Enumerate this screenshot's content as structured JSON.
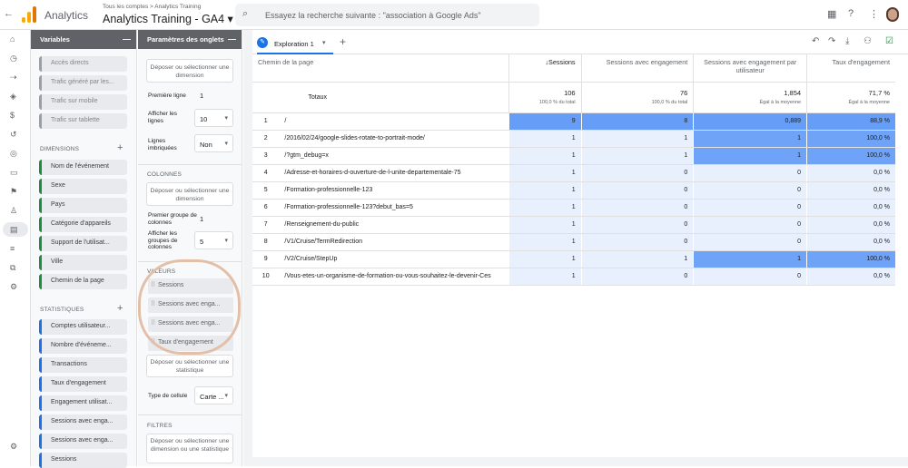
{
  "app": {
    "name": "Analytics",
    "breadcrumb": "Tous les comptes > Analytics Training",
    "property": "Analytics Training - GA4 ▾",
    "search_placeholder": "Essayez la recherche suivante : \"association à Google Ads\"",
    "logo_colors": [
      "#f9ab00",
      "#e37400"
    ]
  },
  "variables": {
    "title": "Variables",
    "segments": [
      "Accès directs",
      "Trafic généré par les...",
      "Trafic sur mobile",
      "Trafic sur tablette"
    ],
    "dimensions_label": "DIMENSIONS",
    "dimensions": [
      "Nom de l'événement",
      "Sexe",
      "Pays",
      "Catégorie d'appareils",
      "Support de l'utilisat...",
      "Ville",
      "Chemin de la page"
    ],
    "metrics_label": "STATISTIQUES",
    "metrics": [
      "Comptes utilisateur...",
      "Nombre d'événeme...",
      "Transactions",
      "Taux d'engagement",
      "Engagement utilisat...",
      "Sessions avec enga...",
      "Sessions avec enga...",
      "Sessions"
    ]
  },
  "settings": {
    "title": "Paramètres des onglets",
    "drop_top": "Déposer ou sélectionner une dimension",
    "first_row_label": "Première ligne",
    "first_row_value": "1",
    "show_rows_label": "Afficher les lignes",
    "show_rows_value": "10",
    "nested_label": "Lignes imbriquées",
    "nested_value": "Non",
    "columns_label": "COLONNES",
    "drop_col": "Déposer ou sélectionner une dimension",
    "first_col_group_label": "Premier groupe de colonnes",
    "first_col_group_value": "1",
    "show_col_groups_label": "Afficher les groupes de colonnes",
    "show_col_groups_value": "5",
    "values_label": "VALEURS",
    "values": [
      "Sessions",
      "Sessions avec enga...",
      "Sessions avec enga...",
      "Taux d'engagement"
    ],
    "drop_stat": "Déposer ou sélectionner une statistique",
    "cell_type_label": "Type de cellule",
    "cell_type_value": "Carte ...",
    "filters_label": "FILTRES",
    "drop_filter": "Déposer ou sélectionner une dimension ou une statistique"
  },
  "exploration": {
    "tab": "Exploration 1",
    "headers": [
      "Chemin de la page",
      "↓Sessions",
      "Sessions avec engagement",
      "Sessions avec engagement par utilisateur",
      "Taux d'engagement"
    ],
    "totals": {
      "label": "Totaux",
      "values": [
        "106",
        "76",
        "1,854",
        "71,7 %"
      ],
      "subs": [
        "100,0 % du total",
        "100,0 % du total",
        "Égal à la moyenne",
        "Égal à la moyenne"
      ]
    },
    "rows": [
      {
        "i": "1",
        "path": "/",
        "v": [
          "9",
          "8",
          "0,889",
          "88,9 %"
        ],
        "s": [
          1,
          1,
          1,
          1
        ]
      },
      {
        "i": "2",
        "path": "/2016/02/24/google-slides-rotate-to-portrait-mode/",
        "v": [
          "1",
          "1",
          "1",
          "100,0 %"
        ],
        "s": [
          0,
          0,
          2,
          2
        ]
      },
      {
        "i": "3",
        "path": "/?gtm_debug=x",
        "v": [
          "1",
          "1",
          "1",
          "100,0 %"
        ],
        "s": [
          0,
          0,
          2,
          2
        ]
      },
      {
        "i": "4",
        "path": "/Adresse-et-horaires-d-ouverture-de-l-unite-departementale-75",
        "v": [
          "1",
          "0",
          "0",
          "0,0 %"
        ],
        "s": [
          0,
          0,
          0,
          0
        ]
      },
      {
        "i": "5",
        "path": "/Formation-professionnelle-123",
        "v": [
          "1",
          "0",
          "0",
          "0,0 %"
        ],
        "s": [
          0,
          0,
          0,
          0
        ]
      },
      {
        "i": "6",
        "path": "/Formation-professionnelle-123?debut_bas=5",
        "v": [
          "1",
          "0",
          "0",
          "0,0 %"
        ],
        "s": [
          0,
          0,
          0,
          0
        ]
      },
      {
        "i": "7",
        "path": "/Renseignement-du-public",
        "v": [
          "1",
          "0",
          "0",
          "0,0 %"
        ],
        "s": [
          0,
          0,
          0,
          0
        ]
      },
      {
        "i": "8",
        "path": "/V1/Cruise/TermRedirection",
        "v": [
          "1",
          "0",
          "0",
          "0,0 %"
        ],
        "s": [
          0,
          0,
          0,
          0
        ]
      },
      {
        "i": "9",
        "path": "/V2/Cruise/StepUp",
        "v": [
          "1",
          "1",
          "1",
          "100,0 %"
        ],
        "s": [
          0,
          0,
          2,
          2
        ]
      },
      {
        "i": "10",
        "path": "/Vous-etes-un-organisme-de-formation-ou-vous-souhaitez-le-devenir-Ces",
        "v": [
          "1",
          "0",
          "0",
          "0,0 %"
        ],
        "s": [
          0,
          0,
          0,
          0
        ]
      }
    ],
    "heat_colors": [
      "#e8f0fe",
      "#669df6",
      "#6fa3f7"
    ]
  }
}
